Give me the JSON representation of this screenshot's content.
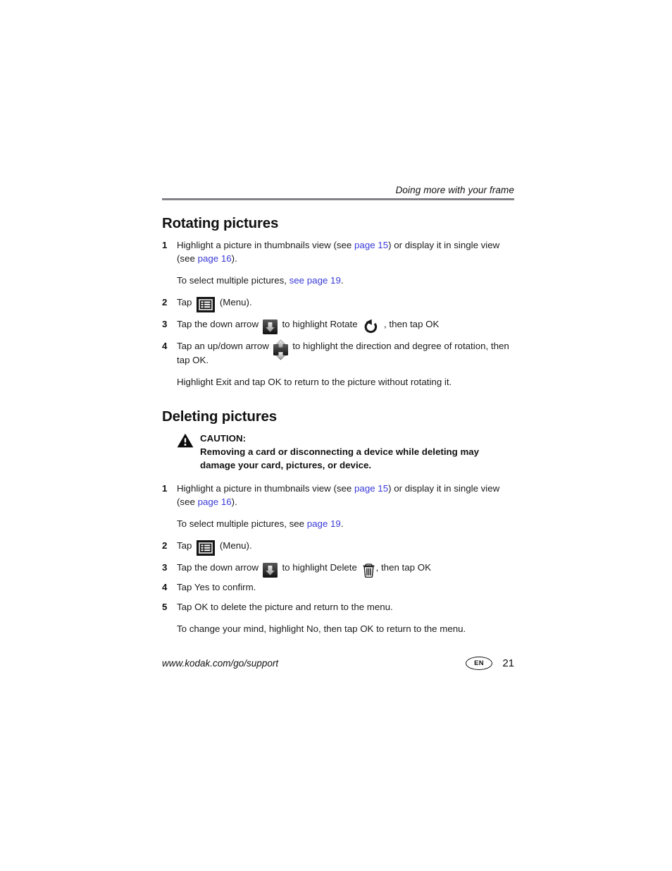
{
  "header": {
    "running_head": "Doing more with your frame"
  },
  "sections": [
    {
      "id": "rotating",
      "title": "Rotating pictures",
      "steps": {
        "s1_num": "1",
        "s1_a": "Highlight a picture in thumbnails view (see ",
        "s1_link1": "page 15",
        "s1_b": ") or display it in single view (see ",
        "s1_link2": "page 16",
        "s1_c": ").",
        "s1_note_a": "To select multiple pictures, ",
        "s1_note_link": "see page 19",
        "s1_note_b": ".",
        "s2_num": "2",
        "s2_a": "Tap ",
        "s2_b": " (Menu).",
        "s3_num": "3",
        "s3_a": "Tap the down arrow ",
        "s3_b": " to highlight Rotate ",
        "s3_c": " , then tap OK",
        "s4_num": "4",
        "s4_a": "Tap an up/down arrow ",
        "s4_b": " to highlight the direction and degree of rotation, then tap OK.",
        "s4_note": "Highlight Exit and tap OK to return to the picture without rotating it."
      }
    },
    {
      "id": "deleting",
      "title": "Deleting pictures",
      "caution": {
        "label": "CAUTION:",
        "body": "Removing a card or disconnecting a device while deleting may damage your card, pictures, or device."
      },
      "steps": {
        "s1_num": "1",
        "s1_a": "Highlight a picture in thumbnails view (see ",
        "s1_link1": "page 15",
        "s1_b": ") or display it in single view (see ",
        "s1_link2": "page 16",
        "s1_c": ").",
        "s1_note_a": "To select multiple pictures, see ",
        "s1_note_link": "page 19",
        "s1_note_b": ".",
        "s2_num": "2",
        "s2_a": "Tap ",
        "s2_b": " (Menu).",
        "s3_num": "3",
        "s3_a": "Tap the down arrow ",
        "s3_b": " to highlight Delete ",
        "s3_c": ", then tap OK",
        "s4_num": "4",
        "s4_text": "Tap Yes to confirm.",
        "s5_num": "5",
        "s5_text": "Tap OK to delete the picture and return to the menu.",
        "s5_note": "To change your mind, highlight No, then tap OK to return to the menu."
      }
    }
  ],
  "footer": {
    "url": "www.kodak.com/go/support",
    "language": "EN",
    "page_number": "21"
  },
  "icons": {
    "menu": "menu-icon",
    "down_arrow": "down-arrow-icon",
    "up_down_arrow": "up-down-arrow-icon",
    "rotate": "rotate-icon",
    "trash": "trash-icon",
    "caution": "caution-triangle-icon"
  },
  "colors": {
    "link": "#3a3ad8",
    "rule": "#808285",
    "text": "#1a1a1a"
  }
}
